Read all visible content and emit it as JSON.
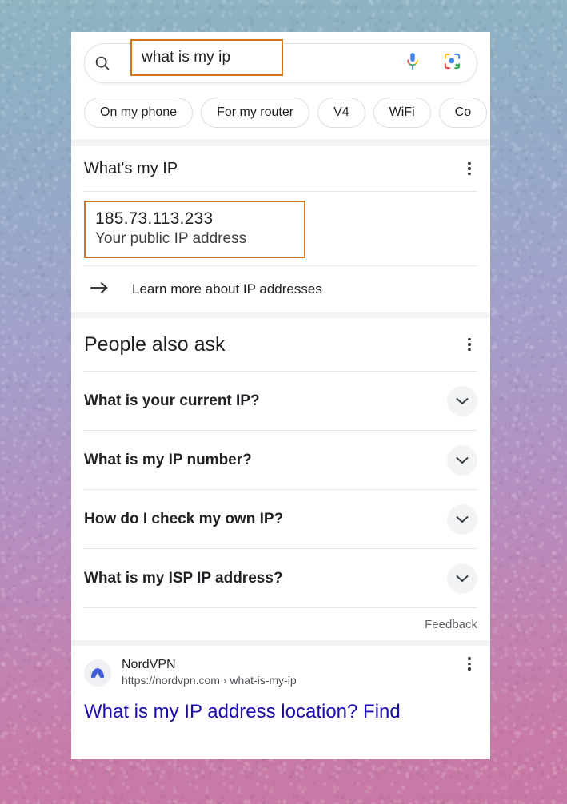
{
  "search": {
    "query": "what is my ip",
    "placeholder": "Search",
    "icons": {
      "search": "search-icon",
      "mic": "microphone-icon",
      "lens": "google-lens-icon"
    }
  },
  "chips": [
    {
      "label": "On my phone"
    },
    {
      "label": "For my router"
    },
    {
      "label": "V4"
    },
    {
      "label": "WiFi"
    },
    {
      "label": "Co"
    }
  ],
  "knowledge_card": {
    "title": "What's my IP",
    "ip_address": "185.73.113.233",
    "ip_caption": "Your public IP address",
    "learn_more": "Learn more about IP addresses",
    "arrow_icon": "arrow-right-icon",
    "overflow_icon": "three-dot-menu-icon"
  },
  "people_also_ask": {
    "title": "People also ask",
    "overflow_icon": "three-dot-menu-icon",
    "questions": [
      {
        "text": "What is your current IP?"
      },
      {
        "text": "What is my IP number?"
      },
      {
        "text": "How do I check my own IP?"
      },
      {
        "text": "What is my ISP IP address?"
      }
    ],
    "feedback_label": "Feedback"
  },
  "result": {
    "site_name": "NordVPN",
    "site_url": "https://nordvpn.com › what-is-my-ip",
    "title": "What is my IP address location? Find",
    "favicon_icon": "nordvpn-logo-icon",
    "overflow_icon": "three-dot-menu-icon"
  },
  "highlight_color": "#d4761e",
  "link_color": "#1a0dab"
}
